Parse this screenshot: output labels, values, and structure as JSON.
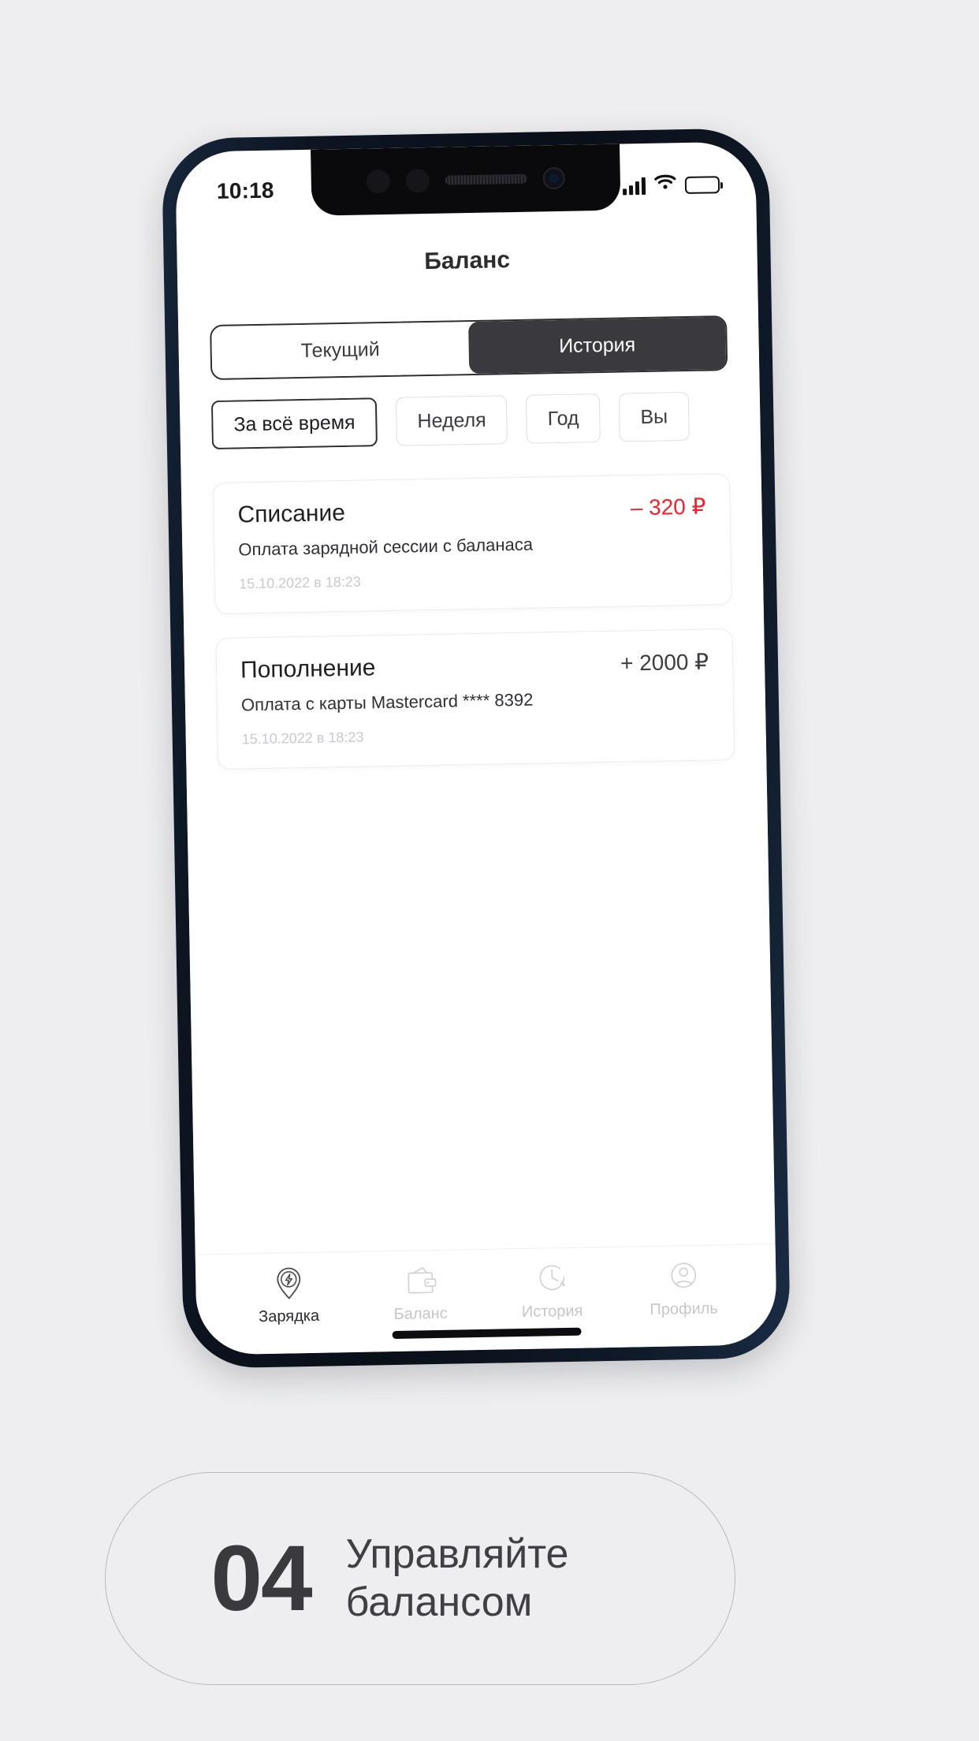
{
  "page": {
    "background_color": "#eeeef0"
  },
  "phone": {
    "frame_color": "#0a0f18",
    "status_bar": {
      "time": "10:18",
      "signal_icon": "signal-bars-icon",
      "wifi_icon": "wifi-icon",
      "battery_icon": "battery-full-icon"
    },
    "notch": {
      "speaker_icon": "earpiece-speaker-icon",
      "camera_icon": "front-camera-icon"
    },
    "home_indicator": "home-indicator-bar"
  },
  "app": {
    "title": "Баланс",
    "segmented_control": {
      "options": [
        {
          "label": "Текущий",
          "active": false
        },
        {
          "label": "История",
          "active": true
        }
      ]
    },
    "filters": [
      {
        "label": "За всё время",
        "selected": true
      },
      {
        "label": "Неделя",
        "selected": false
      },
      {
        "label": "Год",
        "selected": false
      },
      {
        "label": "Вы",
        "selected": false
      }
    ],
    "transactions": [
      {
        "title": "Списание",
        "amount": "– 320 ₽",
        "amount_color": "#f3222c",
        "description": "Оплата зарядной сессии с баланаса",
        "date": "15.10.2022 в 18:23"
      },
      {
        "title": "Пополнение",
        "amount": "+ 2000 ₽",
        "amount_color": "#3d3d42",
        "description": "Оплата с карты Mastercard **** 8392",
        "date": "15.10.2022 в 18:23"
      }
    ],
    "bottom_nav": [
      {
        "label": "Зарядка",
        "icon": "map-pin-charging-icon",
        "active": true
      },
      {
        "label": "Баланс",
        "icon": "wallet-icon",
        "active": false
      },
      {
        "label": "История",
        "icon": "clock-history-icon",
        "active": false
      },
      {
        "label": "Профиль",
        "icon": "user-profile-icon",
        "active": false
      }
    ]
  },
  "caption": {
    "number": "04",
    "text": "Управляйте балансом"
  }
}
